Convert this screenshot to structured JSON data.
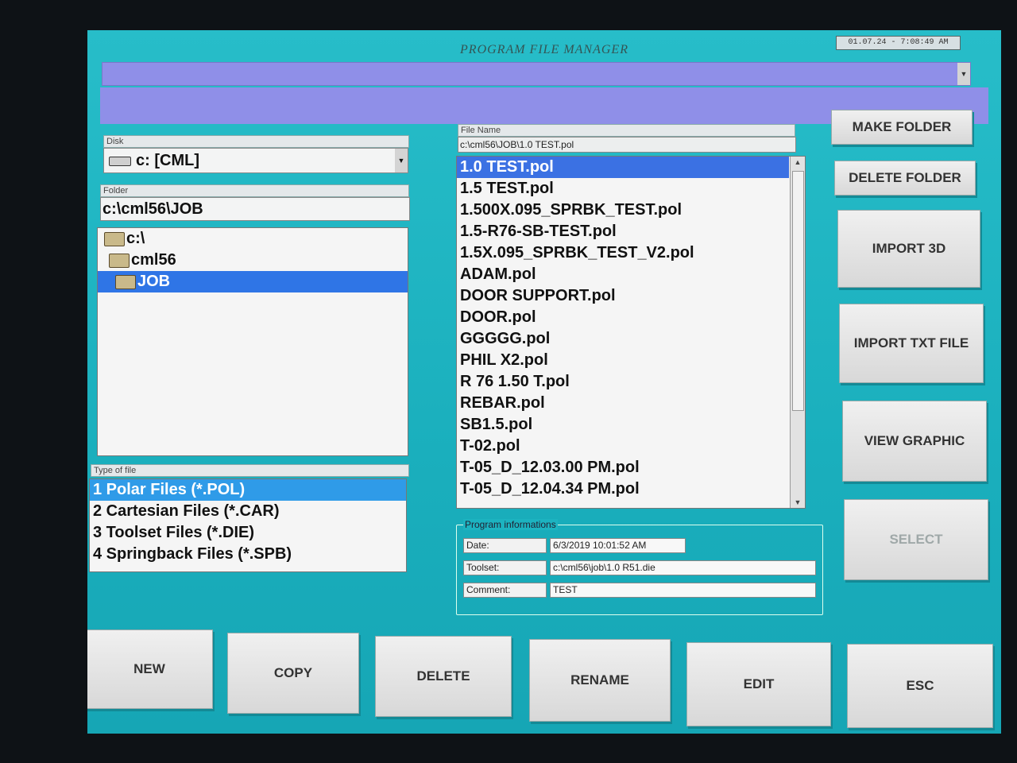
{
  "window": {
    "title": "PROGRAM FILE MANAGER",
    "clock": "01.07.24 - 7:08:49 AM"
  },
  "disk": {
    "caption": "Disk",
    "value": "c: [CML]"
  },
  "folder": {
    "caption": "Folder",
    "value": "c:\\cml56\\JOB",
    "tree": [
      {
        "label": "c:\\",
        "selected": false
      },
      {
        "label": "cml56",
        "selected": false
      },
      {
        "label": "JOB",
        "selected": true
      }
    ]
  },
  "file_type": {
    "caption": "Type of file",
    "items": [
      {
        "label": "1 Polar Files (*.POL)",
        "selected": true
      },
      {
        "label": "2 Cartesian Files (*.CAR)",
        "selected": false
      },
      {
        "label": "3 Toolset Files (*.DIE)",
        "selected": false
      },
      {
        "label": "4 Springback Files (*.SPB)",
        "selected": false
      }
    ]
  },
  "file_name": {
    "caption": "File Name",
    "value": "c:\\cml56\\JOB\\1.0 TEST.pol"
  },
  "files": [
    {
      "label": "1.0 TEST.pol",
      "selected": true
    },
    {
      "label": "1.5 TEST.pol",
      "selected": false
    },
    {
      "label": "1.500X.095_SPRBK_TEST.pol",
      "selected": false
    },
    {
      "label": "1.5-R76-SB-TEST.pol",
      "selected": false
    },
    {
      "label": "1.5X.095_SPRBK_TEST_V2.pol",
      "selected": false
    },
    {
      "label": "ADAM.pol",
      "selected": false
    },
    {
      "label": "DOOR SUPPORT.pol",
      "selected": false
    },
    {
      "label": "DOOR.pol",
      "selected": false
    },
    {
      "label": "GGGGG.pol",
      "selected": false
    },
    {
      "label": "PHIL X2.pol",
      "selected": false
    },
    {
      "label": "R 76 1.50 T.pol",
      "selected": false
    },
    {
      "label": "REBAR.pol",
      "selected": false
    },
    {
      "label": "SB1.5.pol",
      "selected": false
    },
    {
      "label": "T-02.pol",
      "selected": false
    },
    {
      "label": "T-05_D_12.03.00 PM.pol",
      "selected": false
    },
    {
      "label": "T-05_D_12.04.34 PM.pol",
      "selected": false
    }
  ],
  "program_info": {
    "caption": "Program informations",
    "date_label": "Date:",
    "date_value": "6/3/2019 10:01:52 AM",
    "toolset_label": "Toolset:",
    "toolset_value": "c:\\cml56\\job\\1.0 R51.die",
    "comment_label": "Comment:",
    "comment_value": "TEST"
  },
  "side_buttons": {
    "make_folder": "MAKE FOLDER",
    "delete_folder": "DELETE FOLDER",
    "import_3d": "IMPORT 3D",
    "import_txt": "IMPORT TXT FILE",
    "view_graphic": "VIEW GRAPHIC",
    "select": "SELECT"
  },
  "bottom_buttons": {
    "new": "NEW",
    "copy": "COPY",
    "delete": "DELETE",
    "rename": "RENAME",
    "edit": "EDIT",
    "esc": "ESC"
  },
  "colors": {
    "background": "#1cb7c4",
    "selection": "#3b71e3",
    "banner": "#8f8fe8"
  }
}
